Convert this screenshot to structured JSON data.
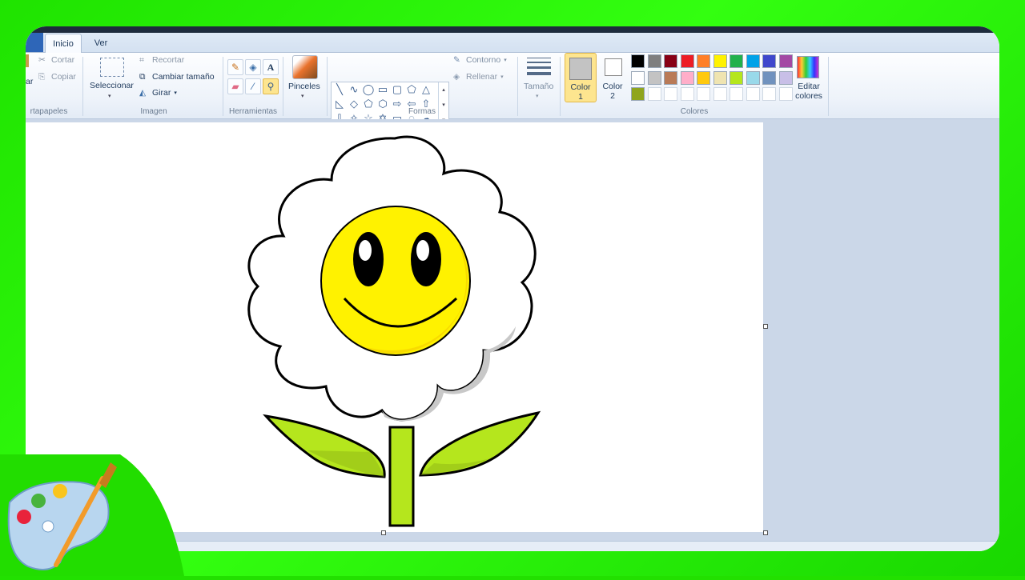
{
  "tabs": [
    {
      "label": "Inicio",
      "active": true
    },
    {
      "label": "Ver",
      "active": false
    }
  ],
  "clipboard": {
    "paste_partial": "ar",
    "cut": "Cortar",
    "copy": "Copiar",
    "group": "rtapapeles"
  },
  "image": {
    "select": "Seleccionar",
    "crop": "Recortar",
    "resize": "Cambiar tamaño",
    "rotate": "Girar",
    "group": "Imagen"
  },
  "tools": {
    "group": "Herramientas",
    "items": [
      "pencil-icon",
      "fill-icon",
      "text-icon",
      "eraser-icon",
      "color-picker-icon",
      "magnifier-icon"
    ]
  },
  "brushes": {
    "label": "Pinceles"
  },
  "shapes": {
    "group": "Formas",
    "outline": "Contorno",
    "fill": "Rellenar"
  },
  "size": {
    "label": "Tamaño"
  },
  "colors": {
    "group": "Colores",
    "color1_a": "Color",
    "color1_b": "1",
    "color2_a": "Color",
    "color2_b": "2",
    "edit_a": "Editar",
    "edit_b": "colores",
    "color1_value": "#c3c3c3",
    "color2_value": "#ffffff",
    "row1": [
      "#000000",
      "#7f7f7f",
      "#880015",
      "#ed1c24",
      "#ff7f27",
      "#fff200",
      "#22b14c",
      "#00a2e8",
      "#3f48cc",
      "#a349a4"
    ],
    "row2": [
      "#ffffff",
      "#c3c3c3",
      "#b97a57",
      "#ffaec9",
      "#ffc90e",
      "#efe4b0",
      "#b5e61d",
      "#99d9ea",
      "#7092be",
      "#c8bfe7"
    ],
    "row3": [
      "#8fa51e"
    ]
  }
}
